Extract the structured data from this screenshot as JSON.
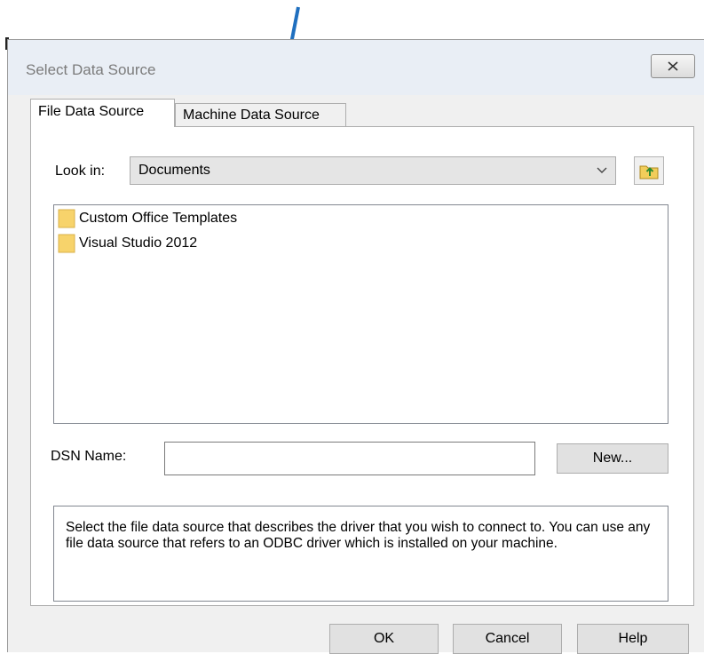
{
  "dialog": {
    "title": "Select Data Source",
    "close_icon": "close-icon"
  },
  "tabs": [
    {
      "label": "File Data Source",
      "active": true
    },
    {
      "label": "Machine Data Source",
      "active": false
    }
  ],
  "look_in": {
    "label": "Look in:",
    "value": "Documents"
  },
  "files": [
    {
      "name": "Custom Office Templates",
      "icon": "folder-icon"
    },
    {
      "name": "Visual Studio 2012",
      "icon": "folder-icon"
    }
  ],
  "dsn": {
    "label": "DSN Name:",
    "value": "",
    "new_button": "New..."
  },
  "description": "Select the file data source that describes the driver that you wish to connect to. You can use any file data source that refers to an ODBC driver which is installed on your machine.",
  "buttons": {
    "ok": "OK",
    "cancel": "Cancel",
    "help": "Help"
  },
  "colors": {
    "arrow": "#1f6fbf",
    "folder": "#f7d36b"
  }
}
